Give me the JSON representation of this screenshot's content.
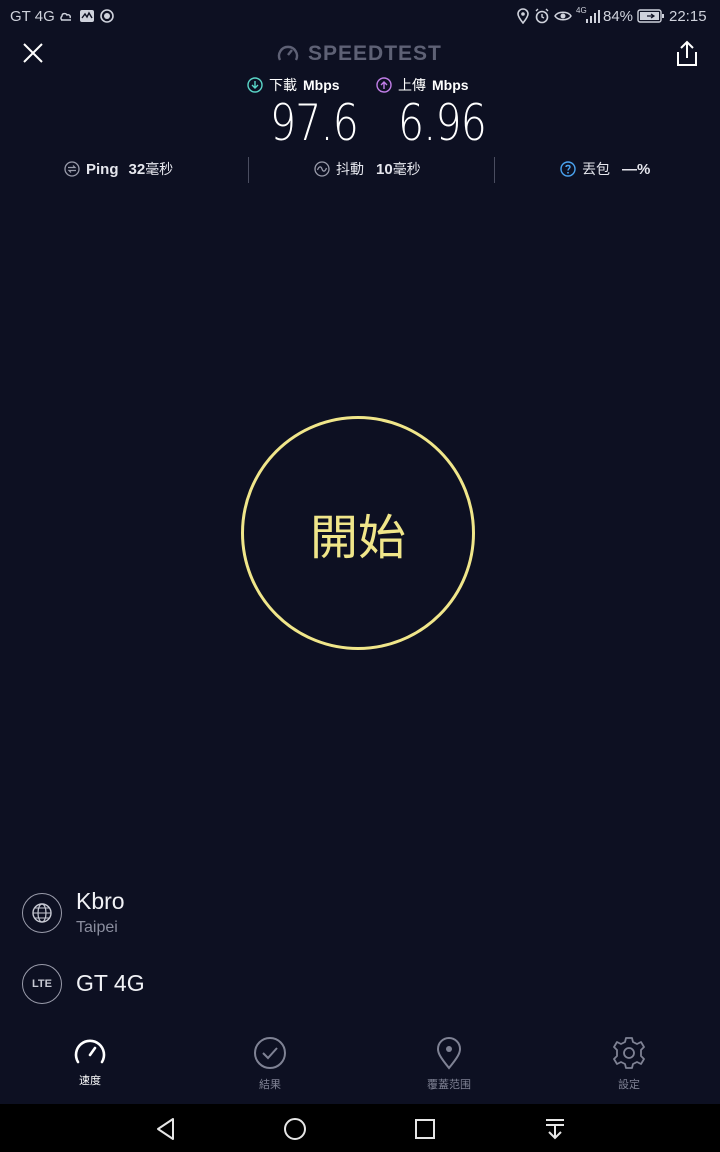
{
  "status_bar": {
    "carrier": "GT 4G",
    "network_tag": "4G",
    "battery": "84%",
    "time": "22:15"
  },
  "header": {
    "logo_text": "SPEEDTEST"
  },
  "download": {
    "label": "下載",
    "unit": "Mbps",
    "value": "97.6"
  },
  "upload": {
    "label": "上傳",
    "unit": "Mbps",
    "value": "6.96"
  },
  "metrics": {
    "ping": {
      "label": "Ping",
      "value": "32",
      "unit": "毫秒"
    },
    "jitter": {
      "label": "抖動",
      "value": "10",
      "unit": "毫秒"
    },
    "loss": {
      "label": "丟包",
      "value": "—",
      "unit": "%"
    }
  },
  "start_button": {
    "label": "開始"
  },
  "server": {
    "isp": "Kbro",
    "city": "Taipei"
  },
  "connection": {
    "badge": "LTE",
    "name": "GT 4G"
  },
  "tabs": [
    {
      "label": "速度",
      "icon": "speedometer-icon",
      "active": true
    },
    {
      "label": "結果",
      "icon": "checkmark-icon",
      "active": false
    },
    {
      "label": "覆蓋范围",
      "icon": "map-pin-icon",
      "active": false
    },
    {
      "label": "設定",
      "icon": "gear-icon",
      "active": false
    }
  ],
  "colors": {
    "background": "#0d1022",
    "accent_yellow": "#f0e68a",
    "download_teal": "#5ad6c8",
    "upload_purple": "#c17ee8"
  }
}
